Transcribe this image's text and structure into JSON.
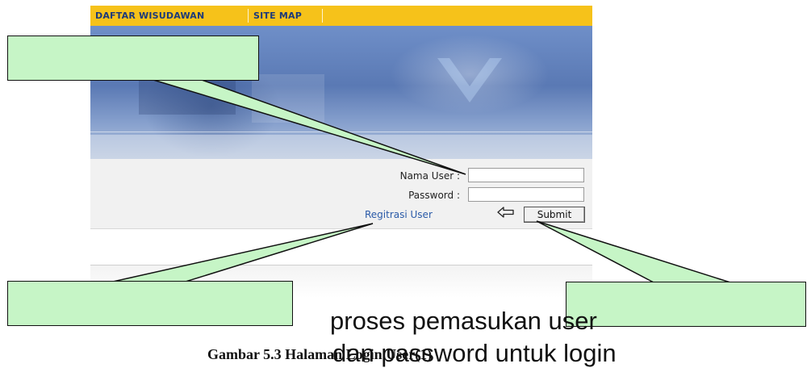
{
  "nav": {
    "items": [
      {
        "label": "DAFTAR WISUDAWAN"
      },
      {
        "label": "SITE MAP"
      }
    ]
  },
  "login": {
    "username_label": "Nama User :",
    "username_value": "",
    "password_label": "Password :",
    "password_value": "",
    "register_link": "Regitrasi User",
    "submit_label": "Submit"
  },
  "annotation": {
    "line1": "proses pemasukan user",
    "line2": "dan password untuk login"
  },
  "caption": {
    "figure": "Gambar 5.3 Halaman Login User(1)"
  },
  "colors": {
    "nav_bg": "#f6c21a",
    "nav_text": "#1c3a7a",
    "link": "#2a5aa8",
    "callout_fill": "#c6f5c6"
  },
  "icons": {
    "submit_arrow": "left-arrow-icon"
  }
}
